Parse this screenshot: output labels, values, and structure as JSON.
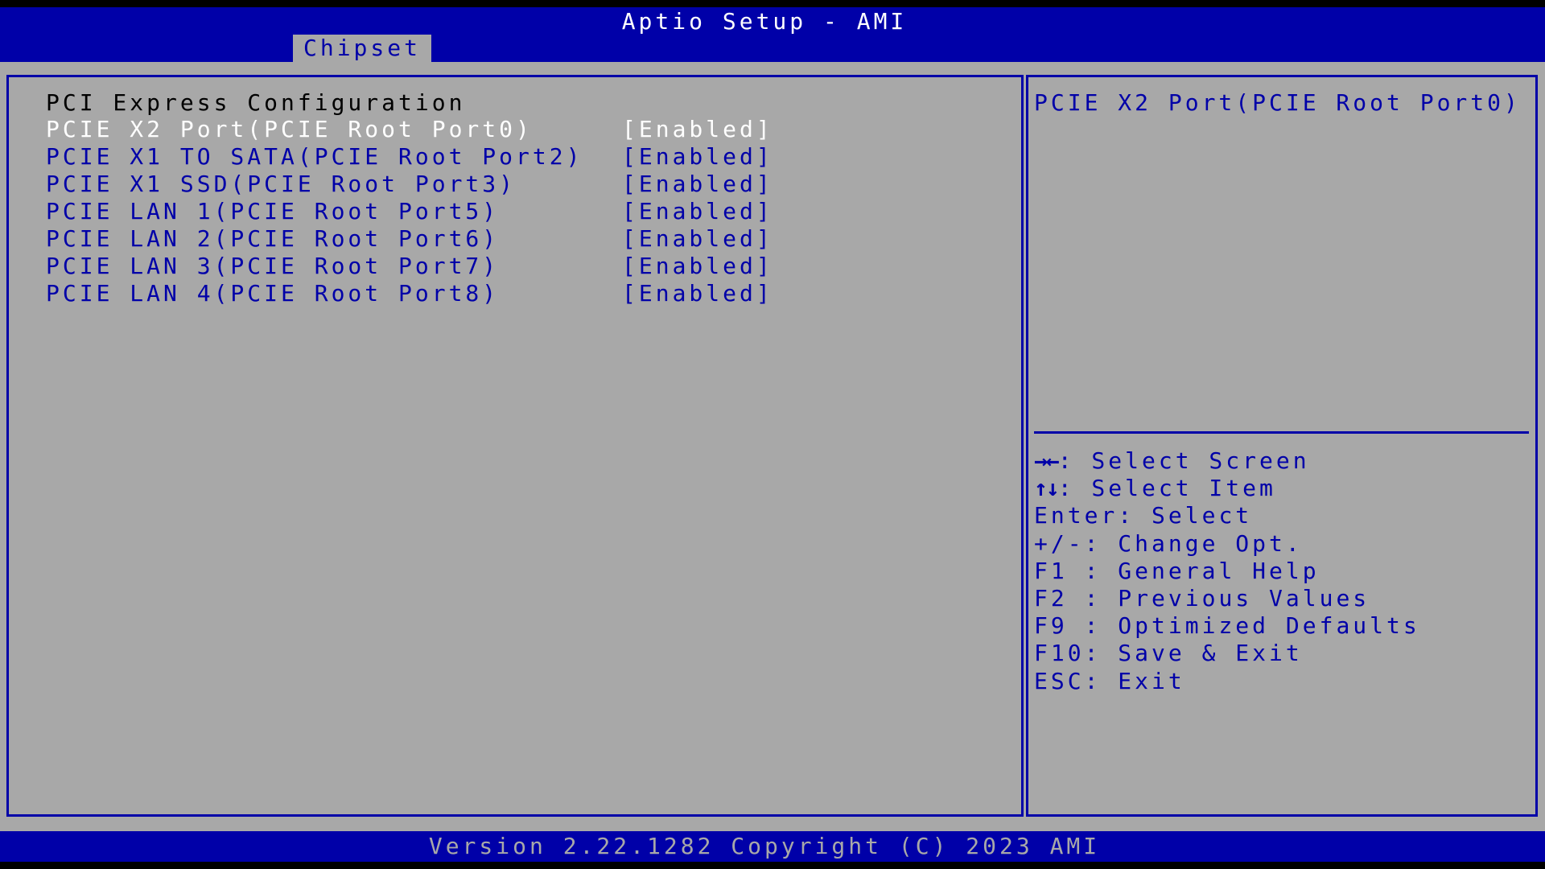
{
  "header": {
    "title": "Aptio Setup - AMI",
    "tab_label": "Chipset"
  },
  "main": {
    "section_title": "PCI Express Configuration",
    "items": [
      {
        "label": "PCIE X2 Port(PCIE Root Port0)",
        "value": "[Enabled]",
        "selected": true
      },
      {
        "label": "PCIE X1 TO SATA(PCIE Root Port2)",
        "value": "[Enabled]",
        "selected": false
      },
      {
        "label": "PCIE X1 SSD(PCIE Root Port3)",
        "value": "[Enabled]",
        "selected": false
      },
      {
        "label": "PCIE LAN 1(PCIE Root Port5)",
        "value": "[Enabled]",
        "selected": false
      },
      {
        "label": "PCIE LAN 2(PCIE Root Port6)",
        "value": "[Enabled]",
        "selected": false
      },
      {
        "label": "PCIE LAN 3(PCIE Root Port7)",
        "value": "[Enabled]",
        "selected": false
      },
      {
        "label": "PCIE LAN 4(PCIE Root Port8)",
        "value": "[Enabled]",
        "selected": false
      }
    ]
  },
  "help": {
    "text": "PCIE X2 Port(PCIE Root Port0)",
    "keys": [
      {
        "key": "→←",
        "icon": "left-right-arrows-icon",
        "desc": ": Select Screen"
      },
      {
        "key": "↑↓",
        "icon": "up-down-arrows-icon",
        "desc": ": Select Item"
      },
      {
        "key": "Enter",
        "desc": ": Select"
      },
      {
        "key": "+/-",
        "desc": ": Change Opt."
      },
      {
        "key": "F1 ",
        "desc": ": General Help"
      },
      {
        "key": "F2 ",
        "desc": ": Previous Values"
      },
      {
        "key": "F9 ",
        "desc": ": Optimized Defaults"
      },
      {
        "key": "F10",
        "desc": ": Save & Exit"
      },
      {
        "key": "ESC",
        "desc": ": Exit"
      }
    ]
  },
  "footer": {
    "text": "Version 2.22.1282 Copyright (C) 2023 AMI"
  },
  "colors": {
    "bios_blue": "#0000a8",
    "bios_gray": "#a8a8a8",
    "selected_text": "#ffffff"
  }
}
